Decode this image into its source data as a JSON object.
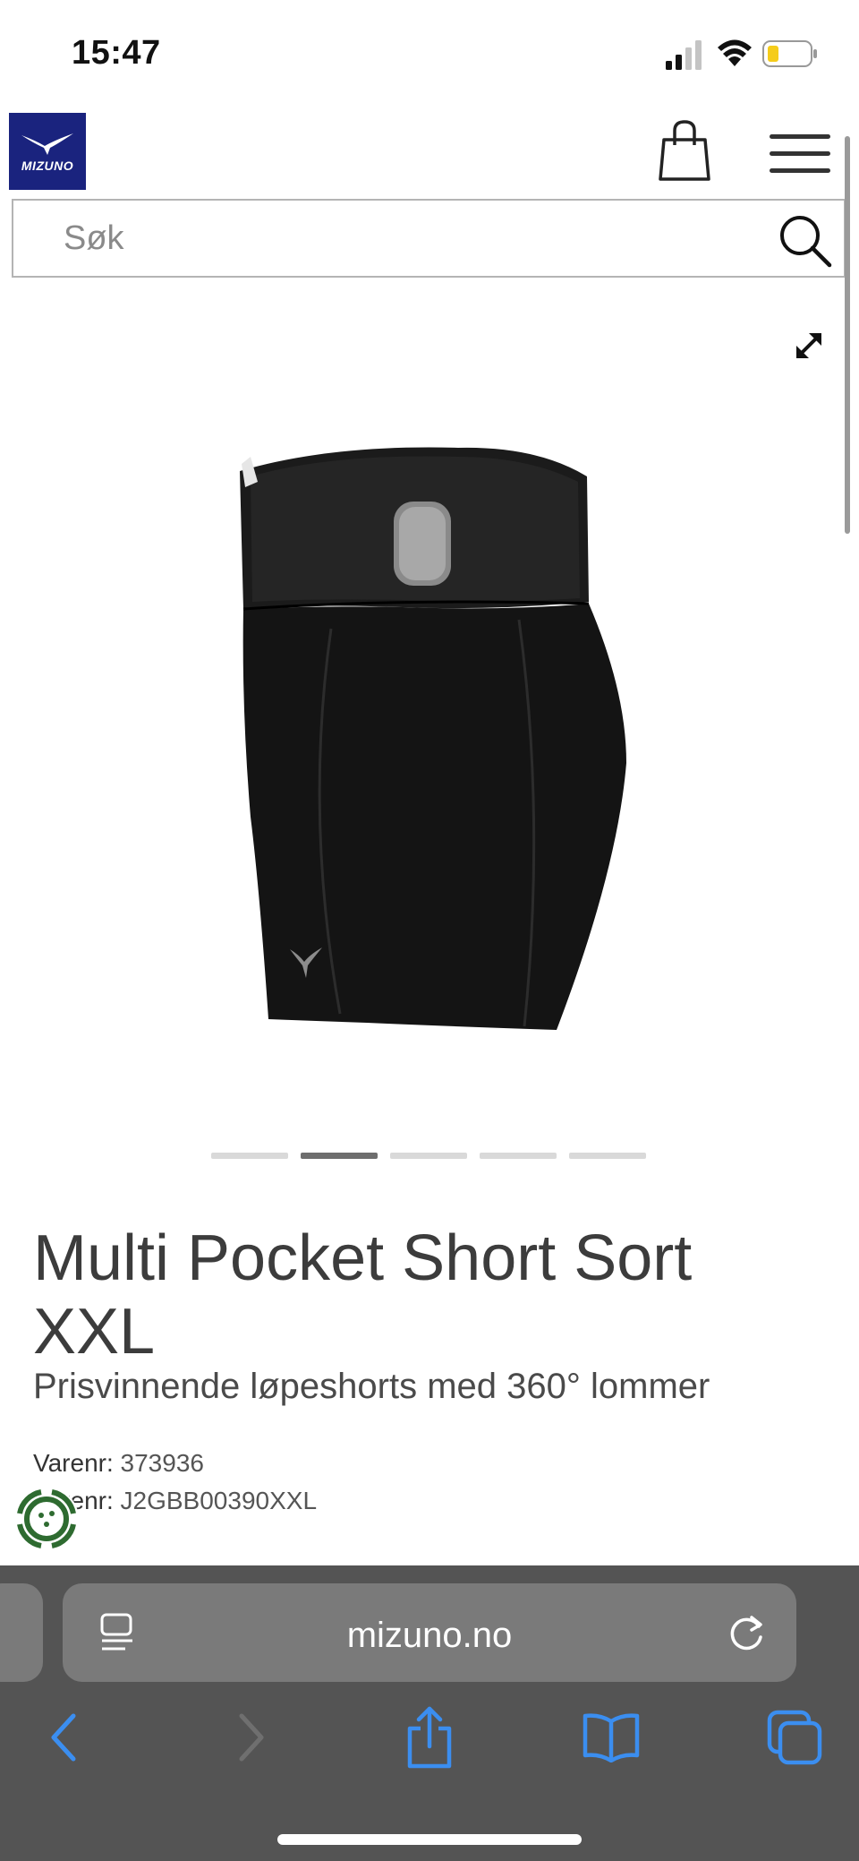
{
  "status_bar": {
    "time": "15:47"
  },
  "header": {
    "logo_text": "MIZUNO"
  },
  "search": {
    "placeholder": "Søk"
  },
  "product": {
    "title": "Multi Pocket Short Sort XXL",
    "subtitle": "Prisvinnende løpeshorts med 360° lommer",
    "sku": [
      {
        "label": "Varenr:",
        "value": "373936"
      },
      {
        "label": "Varenr:",
        "value": "J2GBB00390XXL"
      }
    ],
    "image_count": 5,
    "active_image": 2
  },
  "browser": {
    "url": "mizuno.no"
  },
  "colors": {
    "brand": "#1a237e",
    "browser_bar": "#545454",
    "accent_blue": "#3b8ef0"
  }
}
